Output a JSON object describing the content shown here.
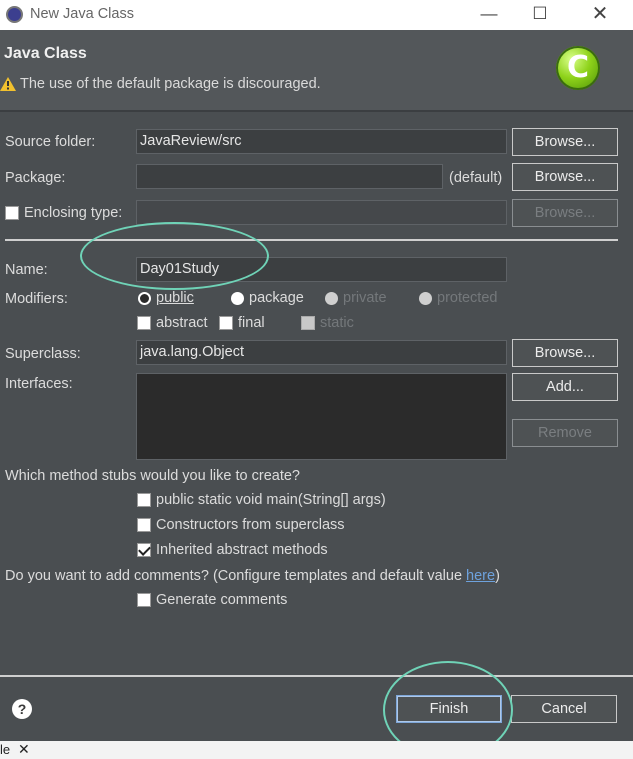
{
  "window": {
    "title": "New Java Class"
  },
  "header": {
    "title": "Java Class",
    "warning": "The use of the default package is discouraged."
  },
  "form": {
    "source_folder": {
      "label": "Source folder:",
      "value": "JavaReview/src",
      "browse": "Browse..."
    },
    "package": {
      "label": "Package:",
      "value": "",
      "suffix": "(default)",
      "browse": "Browse..."
    },
    "enclosing_type": {
      "label": "Enclosing type:",
      "value": "",
      "browse": "Browse..."
    },
    "name": {
      "label": "Name:",
      "value": "Day01Study"
    },
    "modifiers": {
      "label": "Modifiers:",
      "public": "public",
      "package": "package",
      "private": "private",
      "protected": "protected",
      "abstract": "abstract",
      "final": "final",
      "static": "static"
    },
    "superclass": {
      "label": "Superclass:",
      "value": "java.lang.Object",
      "browse": "Browse..."
    },
    "interfaces": {
      "label": "Interfaces:",
      "add": "Add...",
      "remove": "Remove"
    },
    "stubs": {
      "question": "Which method stubs would you like to create?",
      "main": "public static void main(String[] args)",
      "constructors": "Constructors from superclass",
      "inherited": "Inherited abstract methods"
    },
    "comments": {
      "question_prefix": "Do you want to add comments? (Configure templates and default value ",
      "link": "here",
      "question_suffix": ")",
      "generate": "Generate comments"
    }
  },
  "footer": {
    "help": "?",
    "finish": "Finish",
    "cancel": "Cancel"
  },
  "background_tab": {
    "label": "le"
  },
  "colors": {
    "accent_ellipse": "#6fd3b7",
    "link": "#6ea2dd",
    "dialog_bg": "#4a4e51"
  }
}
